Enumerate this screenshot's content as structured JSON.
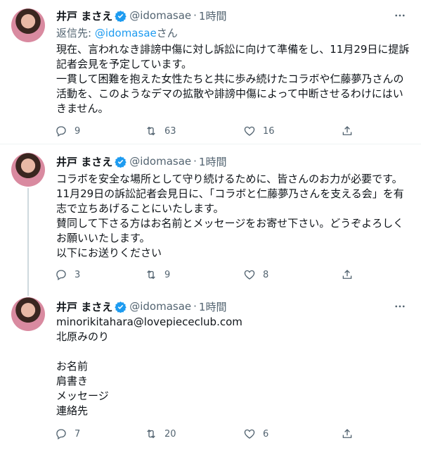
{
  "tweets": [
    {
      "name": "井戸 まさえ",
      "handle": "@idomasae",
      "dot": "·",
      "time": "1時間",
      "replying_prefix": "返信先: ",
      "replying_handle": "@idomasae",
      "replying_suffix": "さん",
      "lines": [
        "現在、言われなき誹謗中傷に対し訴訟に向けて準備をし、11月29日に提訴",
        "記者会見を予定しています。",
        "一貫して困難を抱えた女性たちと共に歩み続けたコラボや仁藤夢乃さんの",
        "活動を、このようなデマの拡散や誹謗中傷によって中断させるわけにはい",
        "きません。"
      ],
      "replies": "9",
      "retweets": "63",
      "likes": "16"
    },
    {
      "name": "井戸 まさえ",
      "handle": "@idomasae",
      "dot": "·",
      "time": "1時間",
      "lines": [
        "コラボを安全な場所として守り続けるために、皆さんのお力が必要です。",
        "11月29日の訴訟記者会見日に、「コラボと仁藤夢乃さんを支える会」を有",
        "志で立ちあげることにいたします。",
        "賛同して下さる方はお名前とメッセージをお寄せ下さい。どうぞよろしく",
        "お願いいたします。",
        "以下にお送りください"
      ],
      "replies": "3",
      "retweets": "9",
      "likes": "8"
    },
    {
      "name": "井戸 まさえ",
      "handle": "@idomasae",
      "dot": "·",
      "time": "1時間",
      "lines": [
        "minorikitahara@lovepiececlub.com",
        "北原みのり",
        "",
        "お名前",
        "肩書き",
        "メッセージ",
        "連絡先"
      ],
      "replies": "7",
      "retweets": "20",
      "likes": "6"
    }
  ],
  "icons": {
    "verified": "verified-badge-icon",
    "more": "more-dots-icon",
    "reply": "reply-bubble-icon",
    "retweet": "retweet-icon",
    "like": "heart-icon",
    "share": "share-upload-icon"
  },
  "colors": {
    "accent": "#1d9bf0",
    "secondary_text": "#536471",
    "primary_text": "#0f1419",
    "divider": "#eff3f4"
  }
}
